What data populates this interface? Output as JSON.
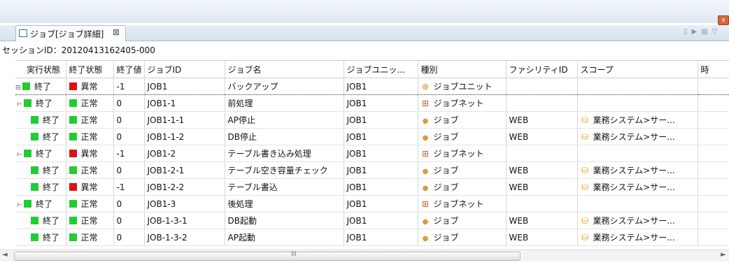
{
  "tab": {
    "label": "ジョブ[ジョブ詳細]",
    "close": "⊠"
  },
  "window_close": "x",
  "session": "セッションID：20120413162405-000",
  "columns": [
    "実行状態",
    "終了状態",
    "終了値",
    "ジョブID",
    "ジョブ名",
    "ジョブユニッ...",
    "種別",
    "ファシリティID",
    "スコープ",
    "時"
  ],
  "rows": [
    {
      "run": "終了",
      "end": "異常",
      "endColor": "red",
      "val": "-1",
      "id": "JOB1",
      "name": "バックアップ",
      "unit": "JOB1",
      "type": "ジョブユニット",
      "typeIcon": "unit",
      "fac": "",
      "scope": "",
      "level": 0,
      "toggle": "⊟"
    },
    {
      "run": "終了",
      "end": "正常",
      "endColor": "green",
      "val": "0",
      "id": "JOB1-1",
      "name": "前処理",
      "unit": "JOB1",
      "type": "ジョブネット",
      "typeIcon": "net",
      "fac": "",
      "scope": "",
      "level": 1,
      "toggle": "⊢"
    },
    {
      "run": "終了",
      "end": "正常",
      "endColor": "green",
      "val": "0",
      "id": "JOB1-1-1",
      "name": "AP停止",
      "unit": "JOB1",
      "type": "ジョブ",
      "typeIcon": "job",
      "fac": "WEB",
      "scope": "業務システム>サー...",
      "level": 2,
      "toggle": ""
    },
    {
      "run": "終了",
      "end": "正常",
      "endColor": "green",
      "val": "0",
      "id": "JOB1-1-2",
      "name": "DB停止",
      "unit": "JOB1",
      "type": "ジョブ",
      "typeIcon": "job",
      "fac": "WEB",
      "scope": "業務システム>サー...",
      "level": 2,
      "toggle": ""
    },
    {
      "run": "終了",
      "end": "異常",
      "endColor": "red",
      "val": "-1",
      "id": "JOB1-2",
      "name": "テーブル書き込み処理",
      "unit": "JOB1",
      "type": "ジョブネット",
      "typeIcon": "net",
      "fac": "",
      "scope": "",
      "level": 1,
      "toggle": "⊢"
    },
    {
      "run": "終了",
      "end": "正常",
      "endColor": "green",
      "val": "0",
      "id": "JOB1-2-1",
      "name": "テーブル空き容量チェック",
      "unit": "JOB1",
      "type": "ジョブ",
      "typeIcon": "job",
      "fac": "WEB",
      "scope": "業務システム>サー...",
      "level": 2,
      "toggle": ""
    },
    {
      "run": "終了",
      "end": "異常",
      "endColor": "red",
      "val": "-1",
      "id": "JOB1-2-2",
      "name": "テーブル書込",
      "unit": "JOB1",
      "type": "ジョブ",
      "typeIcon": "job",
      "fac": "WEB",
      "scope": "業務システム>サー...",
      "level": 2,
      "toggle": ""
    },
    {
      "run": "終了",
      "end": "正常",
      "endColor": "green",
      "val": "0",
      "id": "JOB1-3",
      "name": "後処理",
      "unit": "JOB1",
      "type": "ジョブネット",
      "typeIcon": "net",
      "fac": "",
      "scope": "",
      "level": 1,
      "toggle": "⊢"
    },
    {
      "run": "終了",
      "end": "正常",
      "endColor": "green",
      "val": "0",
      "id": "JOB-1-3-1",
      "name": "DB起動",
      "unit": "JOB1",
      "type": "ジョブ",
      "typeIcon": "job",
      "fac": "WEB",
      "scope": "業務システム>サー...",
      "level": 2,
      "toggle": ""
    },
    {
      "run": "終了",
      "end": "正常",
      "endColor": "green",
      "val": "0",
      "id": "JOB-1-3-2",
      "name": "AP起動",
      "unit": "JOB1",
      "type": "ジョブ",
      "typeIcon": "job",
      "fac": "WEB",
      "scope": "業務システム>サー...",
      "level": 2,
      "toggle": ""
    }
  ],
  "scroll_grip": "III",
  "scroll_left": "◄",
  "scroll_right": "►",
  "colors": {
    "green": "#22cc33",
    "red": "#dd1111"
  }
}
